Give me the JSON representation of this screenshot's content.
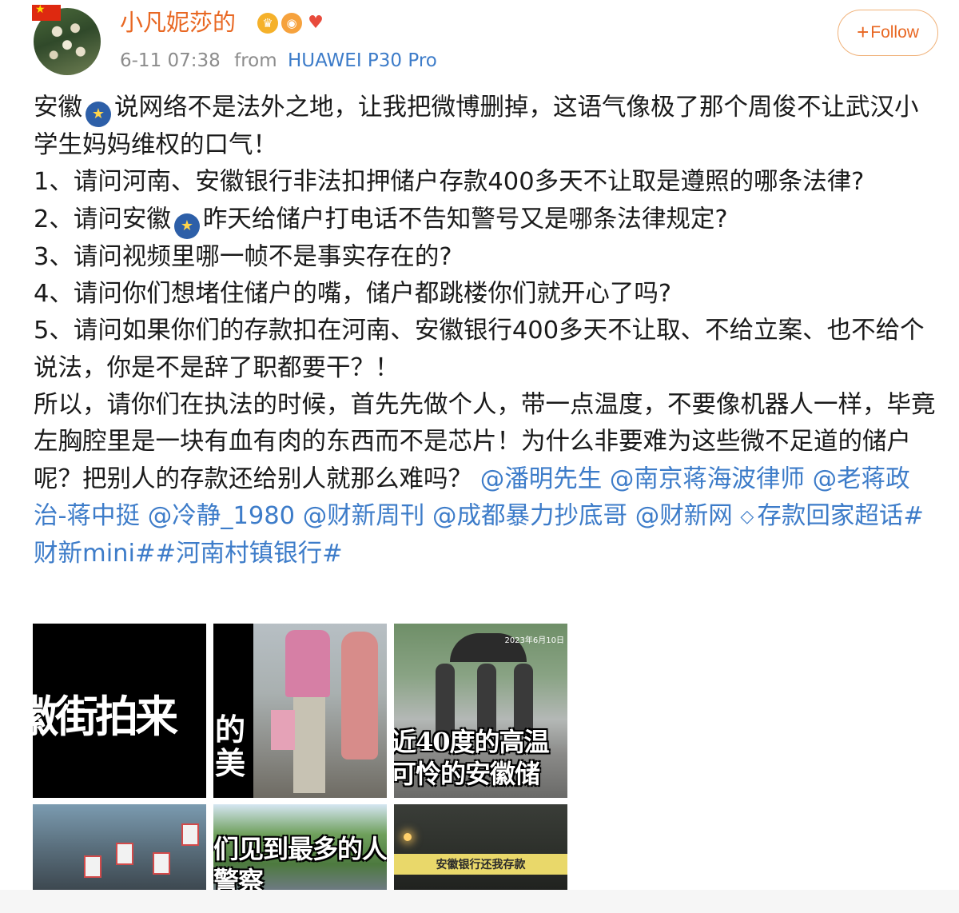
{
  "header": {
    "username": "小凡妮莎的",
    "badges": [
      "crown-badge",
      "fish-badge",
      "bird-badge"
    ],
    "timestamp": "6-11 07:38",
    "from_label": "from",
    "device": "HUAWEI P30 Pro",
    "follow_label": "Follow"
  },
  "post": {
    "p1_a": "安徽",
    "p1_b": "说网络不是法外之地，让我把微博删掉，这语气像极了那个周俊不让武汉小学生妈妈维权的口气！",
    "p2": "1、请问河南、安徽银行非法扣押储户存款400多天不让取是遵照的哪条法律?",
    "p3_a": "2、请问安徽",
    "p3_b": "昨天给储户打电话不告知警号又是哪条法律规定?",
    "p4": "3、请问视频里哪一帧不是事实存在的?",
    "p5": "4、请问你们想堵住储户的嘴，储户都跳楼你们就开心了吗?",
    "p6": "5、请问如果你们的存款扣在河南、安徽银行400多天不让取、不给立案、也不给个说法，你是不是辞了职都要干？！",
    "p7": "所以，请你们在执法的时候，首先先做个人，带一点温度，不要像机器人一样，毕竟左胸腔里是一块有血有肉的东西而不是芯片！为什么非要难为这些微不足道的储户呢？把别人的存款还给别人就那么难吗？",
    "mentions": [
      "@潘明先生",
      "@南京蒋海波律师",
      "@老蒋政治-蒋中挺",
      "@冷静_1980",
      "@财新周刊",
      "@成都暴力抄底哥",
      "@财新网"
    ],
    "topic_super": "存款回家超话",
    "hashtags": [
      "#财新mini#",
      "#河南村镇银行#"
    ]
  },
  "images": {
    "t1_caption": "徽街拍来",
    "t2_caption_1": "的",
    "t2_caption_2": "美",
    "t3_date": "2023年6月10日",
    "t3_caption_1": "近40度的高温",
    "t3_caption_2": "可怜的安徽储",
    "t5_caption_1": "们见到最多的人",
    "t5_caption_2": "警察",
    "t6_banner": "安徽银行还我存款"
  },
  "colors": {
    "username": "#e86722",
    "link": "#3d7cc9",
    "meta": "#8c8c8c",
    "text": "#1a1a1a"
  }
}
